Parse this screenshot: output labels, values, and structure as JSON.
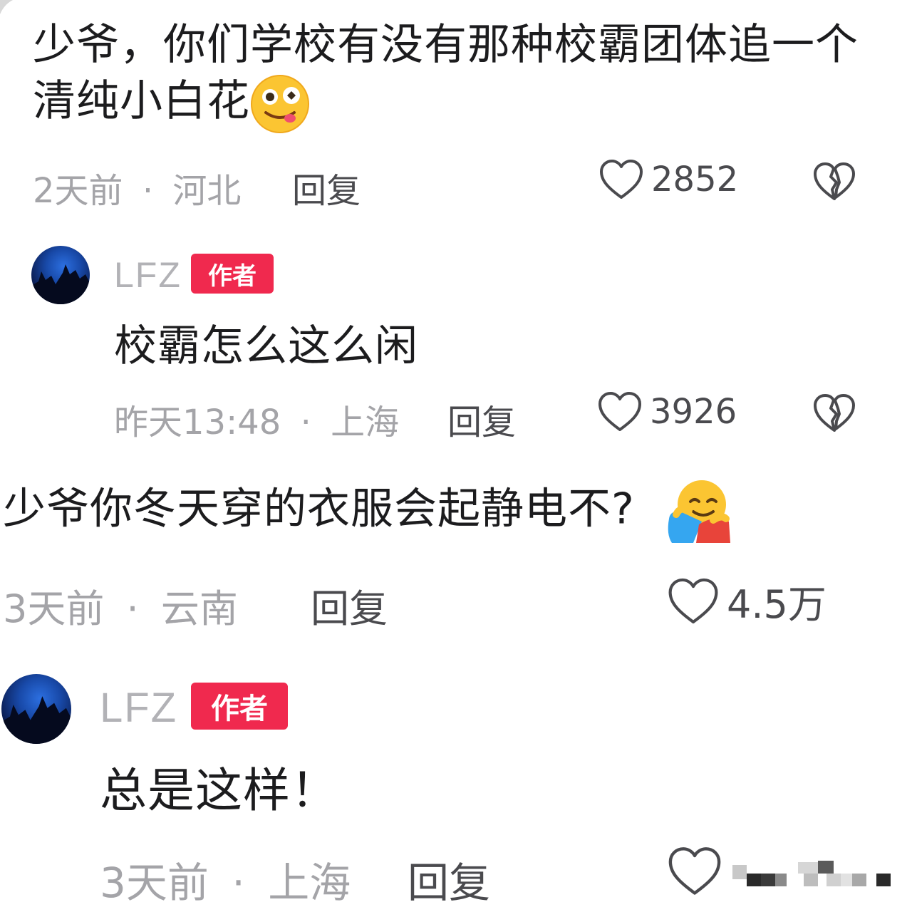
{
  "comments": [
    {
      "text": "少爷，你们学校有没有那种校霸团体追一个清纯小白花",
      "emoji": "drooling-face-emoji",
      "time": "2天前",
      "location": "河北",
      "reply_label": "回复",
      "likes": "2852"
    },
    {
      "username": "LFZ",
      "badge": "作者",
      "text": "校霸怎么这么闲",
      "time": "昨天13:48",
      "location": "上海",
      "reply_label": "回复",
      "likes": "3926"
    },
    {
      "text": "少爷你冬天穿的衣服会起静电不?",
      "emoji": "hugging-face-emoji",
      "time": "3天前",
      "location": "云南",
      "reply_label": "回复",
      "likes": "4.5万"
    },
    {
      "username": "LFZ",
      "badge": "作者",
      "text": "总是这样！",
      "time": "3天前",
      "location": "上海",
      "reply_label": "回复",
      "likes": ""
    }
  ],
  "separator": "·",
  "icons": {
    "like": "heart-outline-icon",
    "dislike": "broken-heart-icon"
  },
  "colors": {
    "badge": "#f0294e",
    "meta": "#a4a4a8",
    "text": "#1c1c1e"
  }
}
